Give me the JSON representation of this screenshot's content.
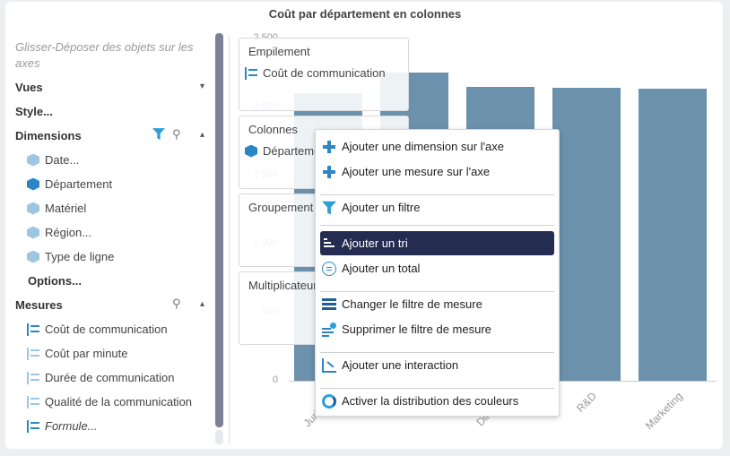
{
  "title": "Coût par département en colonnes",
  "panel": {
    "hint": "Glisser-Déposer des objets sur les axes",
    "sections": {
      "views": "Vues",
      "style": "Style...",
      "dimensions": "Dimensions",
      "options": "Options...",
      "measures": "Mesures"
    },
    "dimensions": [
      "Date...",
      "Département",
      "Matériel",
      "Région...",
      "Type de ligne"
    ],
    "measures": [
      "Coût de communication",
      "Coût par minute",
      "Durée de communication",
      "Qualité de la communication",
      "Formule..."
    ],
    "icons": {
      "filter": "filter-icon",
      "search": "search-icon",
      "dimension": "cube-icon",
      "measure": "measure-icon"
    }
  },
  "dropzones": {
    "stacking": {
      "title": "Empilement",
      "value": "Coût de communication"
    },
    "columns": {
      "title": "Colonnes",
      "value": "Département"
    },
    "grouping": {
      "title": "Groupement"
    },
    "multiplier": {
      "title": "Multiplicateur"
    }
  },
  "chart_data": {
    "type": "bar",
    "categories": [
      "Juridique",
      "",
      "Direction",
      "R&D",
      "Marketing"
    ],
    "values": [
      2100,
      2250,
      2145,
      2140,
      2135
    ],
    "yticks": [
      "0",
      "500",
      "1 000",
      "1 500",
      "2 000",
      "2 500"
    ],
    "ylim": [
      0,
      2500
    ],
    "color": "#6b91ad"
  },
  "menu": {
    "items": [
      {
        "label": "Ajouter une dimension sur l'axe",
        "icon": "plus-icon"
      },
      {
        "label": "Ajouter une mesure sur l'axe",
        "icon": "plus-icon"
      },
      {
        "label": "Ajouter un filtre",
        "icon": "funnel-icon"
      },
      {
        "label": "Ajouter un tri",
        "icon": "sort-icon"
      },
      {
        "label": "Ajouter un total",
        "icon": "total-icon"
      },
      {
        "label": "Changer le filtre de mesure",
        "icon": "measure-filter-icon"
      },
      {
        "label": "Supprimer le filtre de mesure",
        "icon": "remove-measure-filter-icon"
      },
      {
        "label": "Ajouter une interaction",
        "icon": "interaction-icon"
      },
      {
        "label": "Activer la distribution des couleurs",
        "icon": "color-distribution-icon"
      }
    ],
    "active_color": "#252c52"
  }
}
